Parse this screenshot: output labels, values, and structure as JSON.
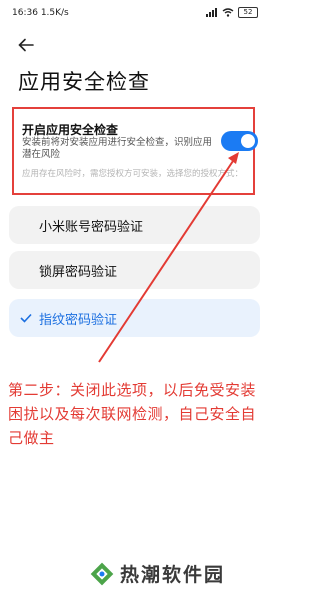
{
  "status_bar": {
    "time": "16:36",
    "speed": "1.5K/s",
    "battery": "52"
  },
  "page": {
    "title": "应用安全检查"
  },
  "setting": {
    "title": "开启应用安全检查",
    "description": "安装前将对安装应用进行安全检查，识别应用潜在风险",
    "hint": "应用存在风险时，需您授权方可安装，选择您的授权方式：",
    "toggle_on": true,
    "accent_color": "#1b7bf3"
  },
  "auth_options": [
    {
      "label": "小米账号密码验证",
      "selected": false
    },
    {
      "label": "锁屏密码验证",
      "selected": false
    },
    {
      "label": "指纹密码验证",
      "selected": true
    }
  ],
  "annotation": {
    "text": "第二步：关闭此选项，以后免受安装困扰以及每次联网检测，自己安全自己做主",
    "color": "#e33b34"
  },
  "watermark": {
    "text": "热潮软件园"
  }
}
